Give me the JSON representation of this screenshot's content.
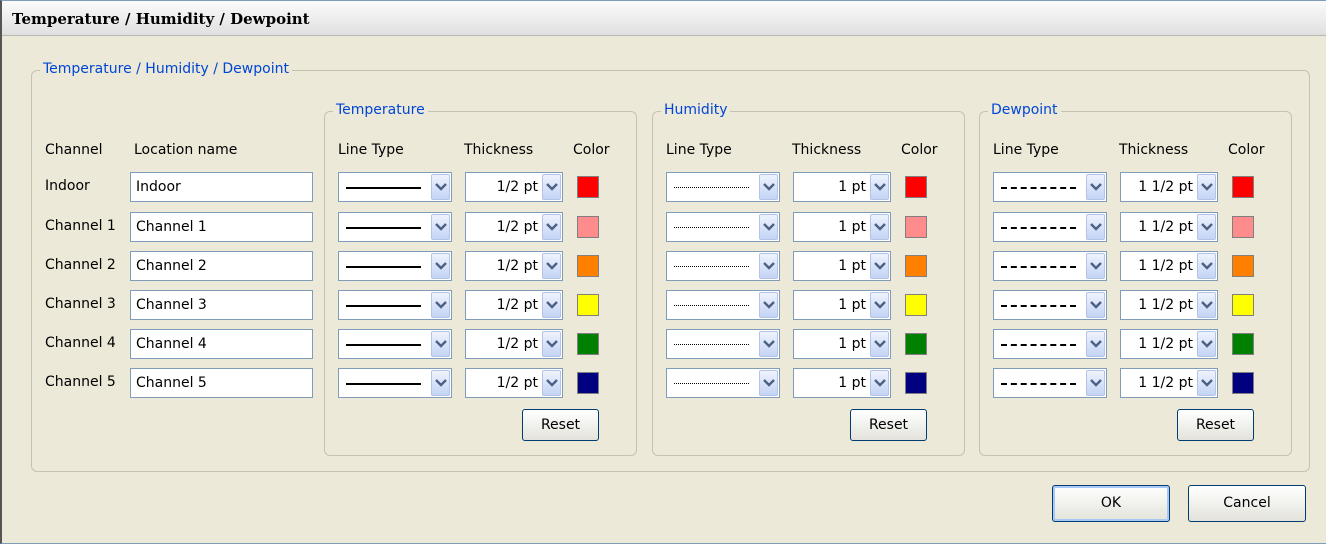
{
  "window": {
    "title": "Temperature / Humidity / Dewpoint"
  },
  "main_group": {
    "title": "Temperature / Humidity / Dewpoint"
  },
  "columns": {
    "channel": "Channel",
    "location": "Location name",
    "line_type": "Line Type",
    "thickness": "Thickness",
    "color": "Color"
  },
  "channels": [
    {
      "label": "Indoor",
      "location": "Indoor"
    },
    {
      "label": "Channel 1",
      "location": "Channel 1"
    },
    {
      "label": "Channel 2",
      "location": "Channel 2"
    },
    {
      "label": "Channel 3",
      "location": "Channel 3"
    },
    {
      "label": "Channel 4",
      "location": "Channel 4"
    },
    {
      "label": "Channel 5",
      "location": "Channel 5"
    }
  ],
  "channel_colors": [
    "#ff0000",
    "#ff8c8c",
    "#ff8000",
    "#ffff00",
    "#008000",
    "#000080"
  ],
  "groups": [
    {
      "title": "Temperature",
      "line_style": "solid",
      "thickness": "1/2 pt",
      "reset_label": "Reset"
    },
    {
      "title": "Humidity",
      "line_style": "dotted",
      "thickness": "1 pt",
      "reset_label": "Reset"
    },
    {
      "title": "Dewpoint",
      "line_style": "dashed",
      "thickness": "1 1/2 pt",
      "reset_label": "Reset"
    }
  ],
  "buttons": {
    "ok": "OK",
    "cancel": "Cancel"
  },
  "icons": {
    "combo_arrow": "chevron-down-icon"
  }
}
